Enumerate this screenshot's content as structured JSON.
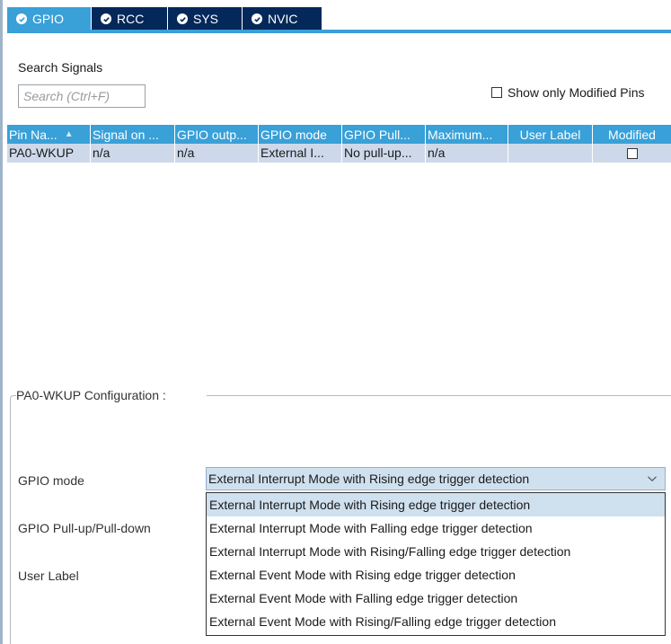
{
  "tabs": [
    {
      "label": "GPIO",
      "active": true
    },
    {
      "label": "RCC",
      "active": false
    },
    {
      "label": "SYS",
      "active": false
    },
    {
      "label": "NVIC",
      "active": false
    }
  ],
  "search": {
    "label": "Search Signals",
    "placeholder": "Search (Ctrl+F)",
    "show_modified_label": "Show only Modified Pins"
  },
  "table": {
    "columns": [
      "Pin Na...",
      "Signal on ...",
      "GPIO outp...",
      "GPIO mode",
      "GPIO Pull...",
      "Maximum...",
      "User Label",
      "Modified"
    ],
    "rows": [
      {
        "cells": [
          "PA0-WKUP",
          "n/a",
          "n/a",
          "External I...",
          "No pull-up...",
          "n/a",
          ""
        ],
        "modified": false
      }
    ]
  },
  "config": {
    "title": "PA0-WKUP Configuration :",
    "fields": {
      "gpio_mode_label": "GPIO mode",
      "pull_label": "GPIO Pull-up/Pull-down",
      "user_label": "User Label"
    },
    "gpio_mode_value": "External Interrupt Mode with Rising edge trigger detection",
    "options": [
      "External Interrupt Mode with Rising edge trigger detection",
      "External Interrupt Mode with Falling edge trigger detection",
      "External Interrupt Mode with Rising/Falling edge trigger detection",
      "External Event Mode with Rising edge trigger detection",
      "External Event Mode with Falling edge trigger detection",
      "External Event Mode with Rising/Falling edge trigger detection"
    ]
  },
  "colors": {
    "tab_active": "#39a0d8",
    "tab_inactive": "#04285a",
    "header_bg": "#39a0d8",
    "row_bg": "#cdd9ea",
    "select_bg": "#cfe0ef"
  },
  "icons": {
    "tab_check": "check-circle-icon",
    "sort": "sort-up-icon",
    "dropdown": "chevron-down-icon"
  }
}
